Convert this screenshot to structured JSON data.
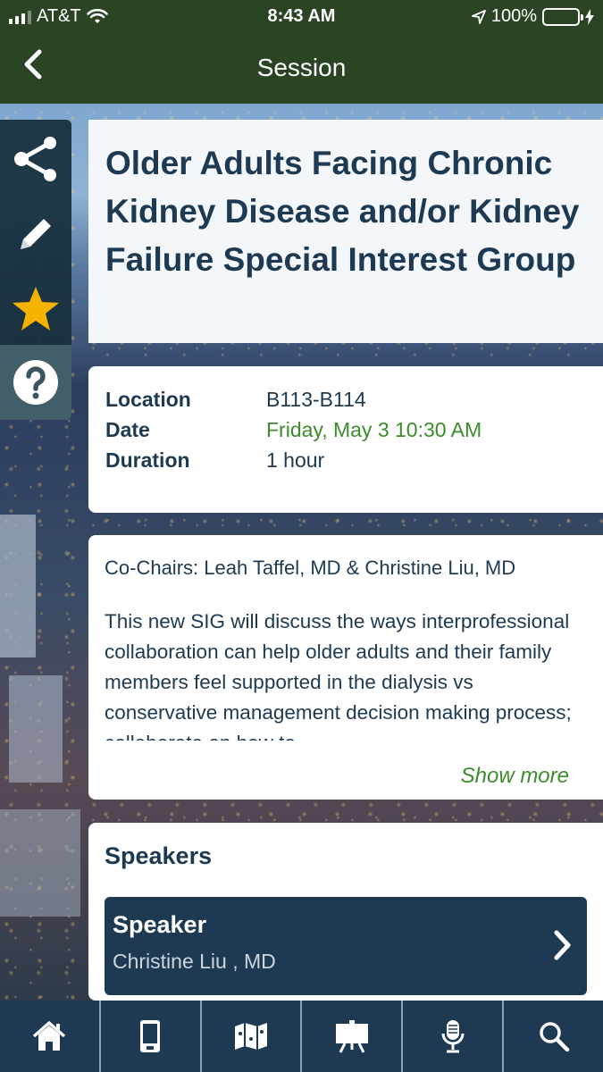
{
  "status_bar": {
    "carrier": "AT&T",
    "time": "8:43 AM",
    "battery": "100%"
  },
  "nav": {
    "title": "Session",
    "back_icon": "chevron-left-icon"
  },
  "sidebar": {
    "buttons": [
      {
        "icon": "share-icon"
      },
      {
        "icon": "pencil-icon"
      },
      {
        "icon": "star-icon",
        "color": "#f5b301"
      },
      {
        "icon": "help-icon"
      }
    ]
  },
  "session": {
    "title": "Older Adults Facing Chronic Kidney Disease and/or Kidney Failure Special Interest Group",
    "details": [
      {
        "label": "Location",
        "value": "B113-B114"
      },
      {
        "label": "Date",
        "value": "Friday, May 3 10:30 AM"
      },
      {
        "label": "Duration",
        "value": "1 hour"
      }
    ],
    "chairs": "Co-Chairs: Leah Taffel, MD & Christine Liu, MD",
    "description": "This new SIG will discuss the ways interprofessional collaboration can help older adults and their family members feel supported in the dialysis vs conservative management decision making process; collaborate on how to",
    "show_more": "Show more"
  },
  "speakers": {
    "heading": "Speakers",
    "items": [
      {
        "role": "Speaker",
        "name": "Christine Liu , MD"
      }
    ]
  },
  "tabbar": {
    "items": [
      {
        "icon": "home-icon"
      },
      {
        "icon": "mobile-device-icon"
      },
      {
        "icon": "map-icon"
      },
      {
        "icon": "presentation-board-icon"
      },
      {
        "icon": "microphone-icon"
      },
      {
        "icon": "search-icon"
      }
    ]
  },
  "colors": {
    "accent_green": "#3c8c2c",
    "navy": "#1d3a52",
    "header_green": "#2a4424"
  }
}
